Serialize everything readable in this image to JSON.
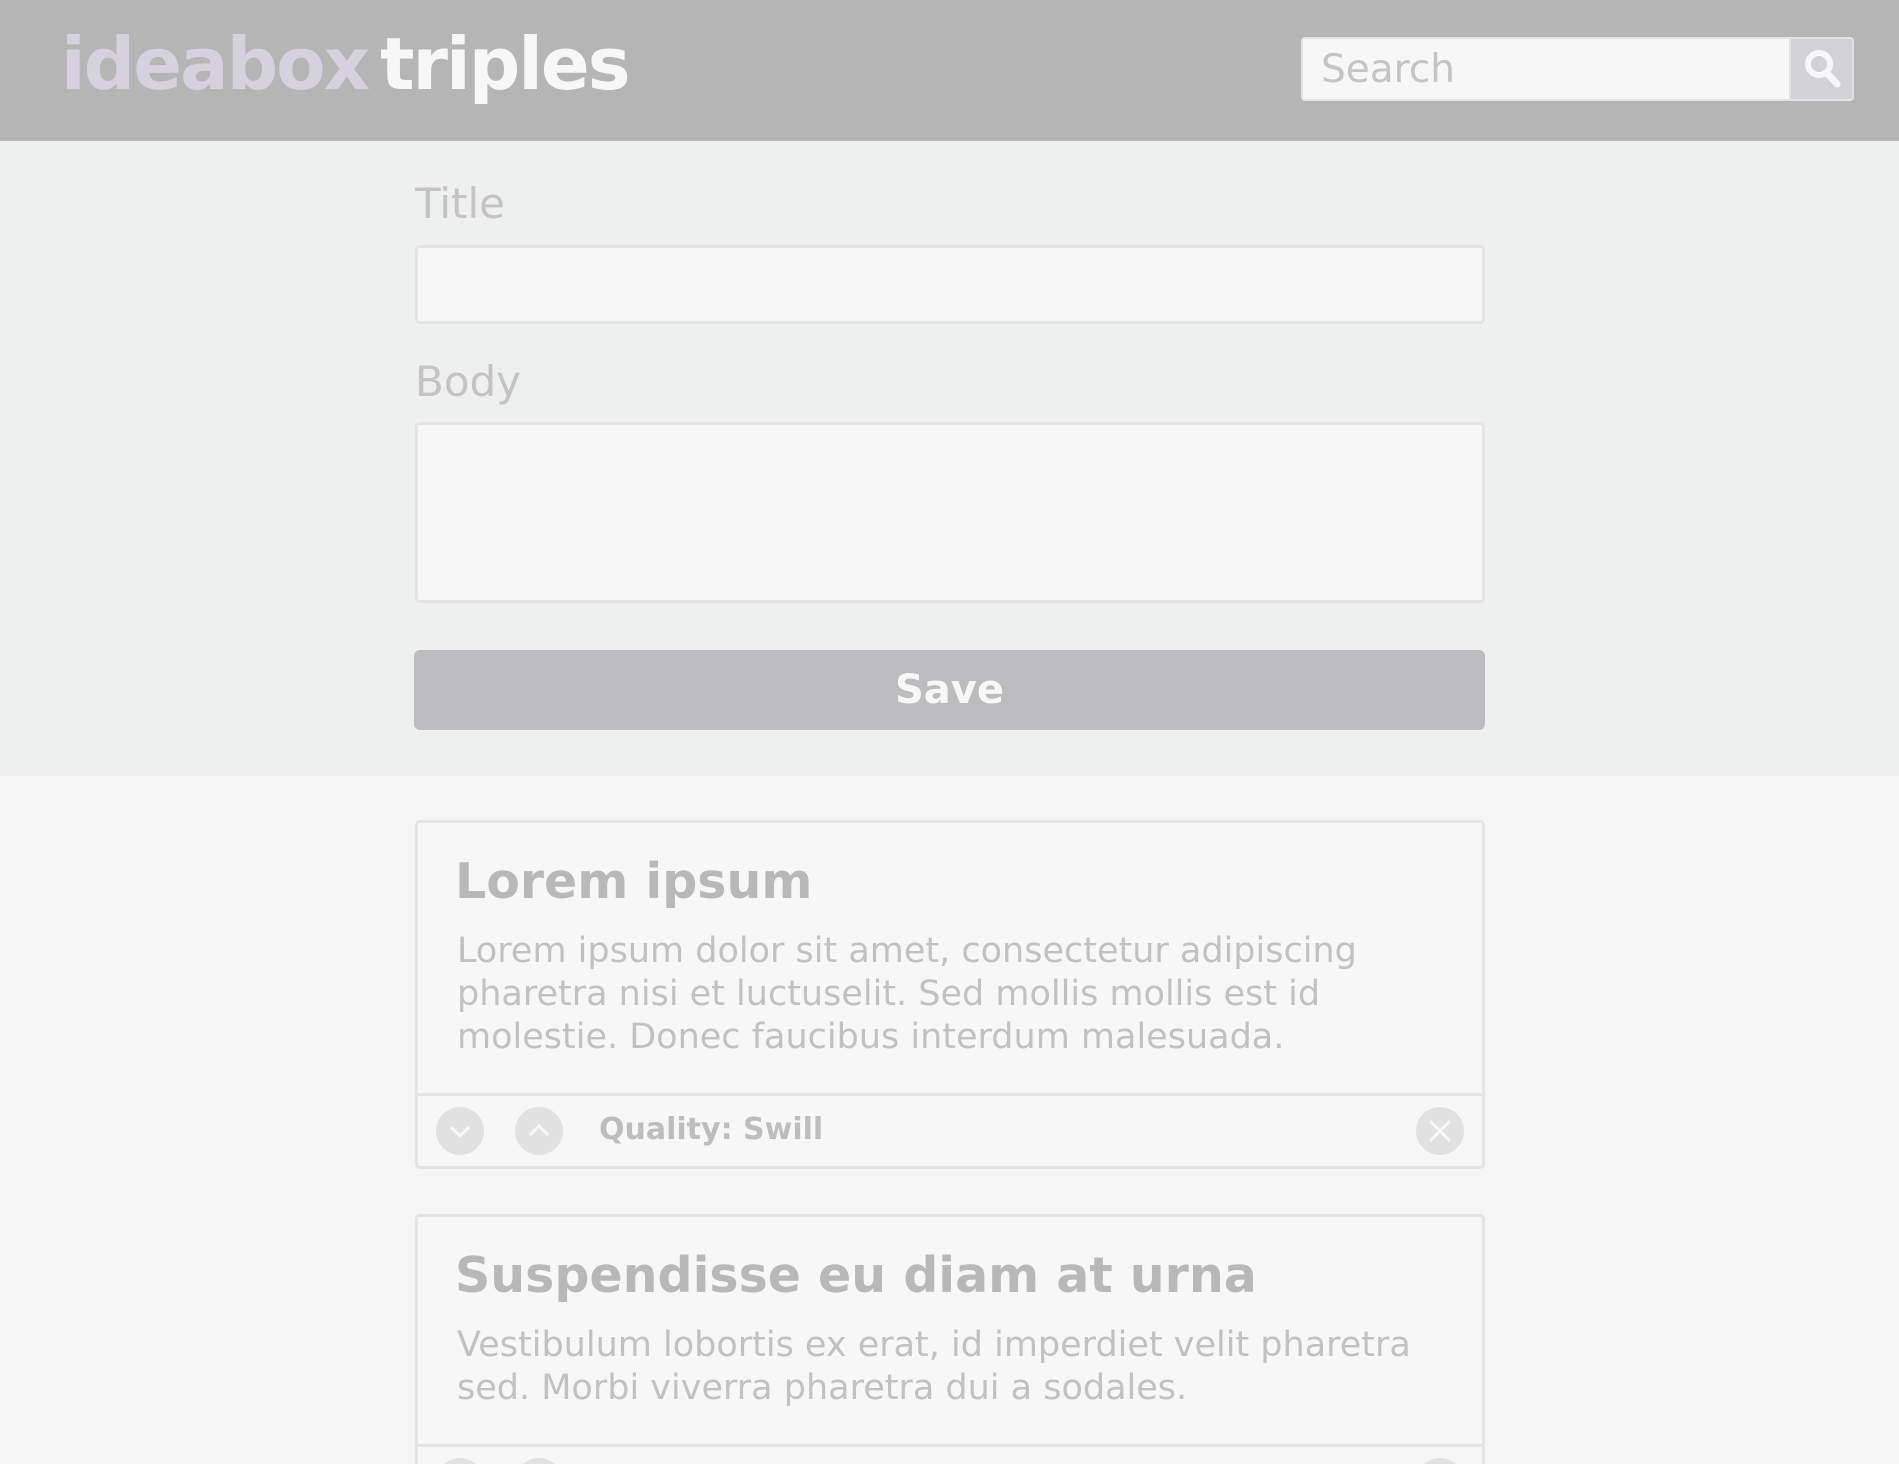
{
  "header": {
    "logo_part1": "ideabox",
    "logo_part2": "triples",
    "search": {
      "placeholder": "Search",
      "button_icon": "search-icon"
    }
  },
  "form": {
    "title_label": "Title",
    "title_value": "",
    "body_label": "Body",
    "body_value": "",
    "save_label": "Save"
  },
  "ideas": [
    {
      "title": "Lorem ipsum",
      "body": "Lorem ipsum dolor sit amet, consectetur adipiscing pharetra nisi et luctuselit. Sed mollis mollis est id molestie. Donec faucibus interdum malesuada.",
      "quality": "Quality: Swill",
      "icons": [
        "chevron-down-icon",
        "chevron-up-icon",
        "close-icon"
      ]
    },
    {
      "title": "Suspendisse eu diam at urna",
      "body": "Vestibulum lobortis ex erat, id imperdiet velit pharetra sed. Morbi viverra pharetra dui a sodales.",
      "quality": "",
      "icons": [
        "chevron-down-icon",
        "chevron-up-icon",
        "close-icon"
      ]
    }
  ],
  "colors": {
    "header_bg": "#b5b5b5",
    "logo_primary": "#d5d2de",
    "logo_secondary": "#f7f7f7",
    "form_bg": "#eef0ef",
    "page_bg": "#f4f5f4",
    "save_button": "#bcbcbe",
    "card_bg": "#f7f7f7"
  }
}
